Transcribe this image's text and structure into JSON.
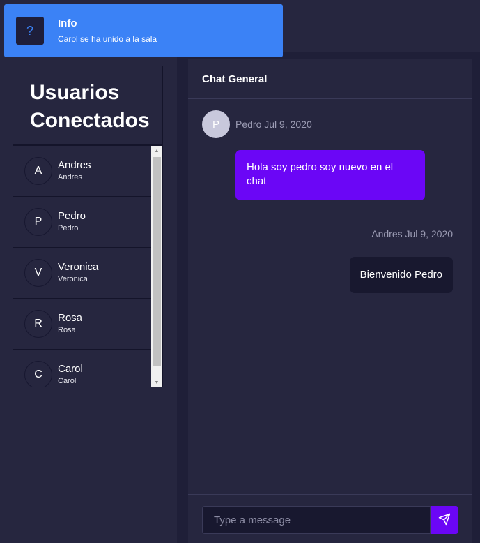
{
  "toast": {
    "title": "Info",
    "message": "Carol se ha unido a la sala",
    "icon": "question-icon",
    "icon_glyph": "?",
    "color": "#3b82f6"
  },
  "users": {
    "title_line1": "Usuarios",
    "title_line2": "Conectados",
    "items": [
      {
        "initial": "A",
        "name": "Andres",
        "username": "Andres"
      },
      {
        "initial": "P",
        "name": "Pedro",
        "username": "Pedro"
      },
      {
        "initial": "V",
        "name": "Veronica",
        "username": "Veronica"
      },
      {
        "initial": "R",
        "name": "Rosa",
        "username": "Rosa"
      },
      {
        "initial": "C",
        "name": "Carol",
        "username": "Carol"
      }
    ]
  },
  "chat": {
    "title": "Chat General",
    "messages": [
      {
        "avatar_initial": "P",
        "meta": "Pedro Jul 9, 2020",
        "text": "Hola soy pedro soy nuevo en el chat"
      },
      {
        "meta": "Andres Jul 9, 2020",
        "text": "Bienvenido Pedro"
      }
    ],
    "input_placeholder": "Type a message",
    "send_icon": "send-icon"
  },
  "colors": {
    "accent": "#6b06f6",
    "background": "#1f1f38",
    "panel": "#26263f",
    "toast": "#3b82f6"
  }
}
